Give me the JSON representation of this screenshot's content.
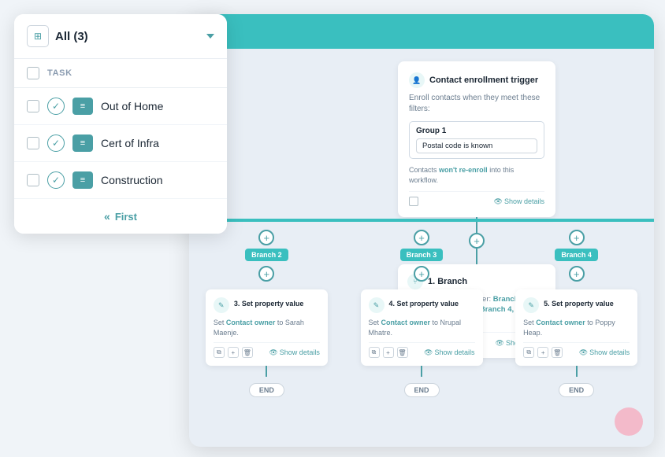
{
  "leftPanel": {
    "headerIcon": "☰",
    "dropdownLabel": "All (3)",
    "taskColumnLabel": "TASK",
    "tasks": [
      {
        "name": "Out of Home",
        "done": true
      },
      {
        "name": "Cert of Infra",
        "done": true
      },
      {
        "name": "Construction",
        "done": true
      }
    ],
    "firstLinkLabel": "First"
  },
  "workflow": {
    "triggerCard": {
      "title": "Contact enrollment trigger",
      "subtitle": "Enroll contacts when they meet these filters:",
      "groupLabel": "Group 1",
      "filterText": "Postal code is known",
      "note": "Contacts won't re-enroll into this workflow.",
      "noteHighlight": "won't re-enroll",
      "showDetails": "Show details"
    },
    "branchCard": {
      "title": "1. Branch",
      "subtitle": "Check branches in order: Branch 1, Branch 2, Branch 3, Branch 4, and None met.",
      "showDetails": "Show details"
    },
    "branches": [
      {
        "label": "Branch 2",
        "actionNum": "3",
        "actionTitle": "3. Set property value",
        "actionText": "Set Contact owner to Sarah Maenje.",
        "showDetails": "Show details"
      },
      {
        "label": "Branch 3",
        "actionNum": "4",
        "actionTitle": "4. Set property value",
        "actionText": "Set Contact owner to Nrupal Mhatre.",
        "showDetails": "Show details"
      },
      {
        "label": "Branch 4",
        "actionNum": "5",
        "actionTitle": "5. Set property value",
        "actionText": "Set Contact owner to Poppy Heap.",
        "showDetails": "Show details"
      }
    ],
    "endLabel": "END"
  }
}
